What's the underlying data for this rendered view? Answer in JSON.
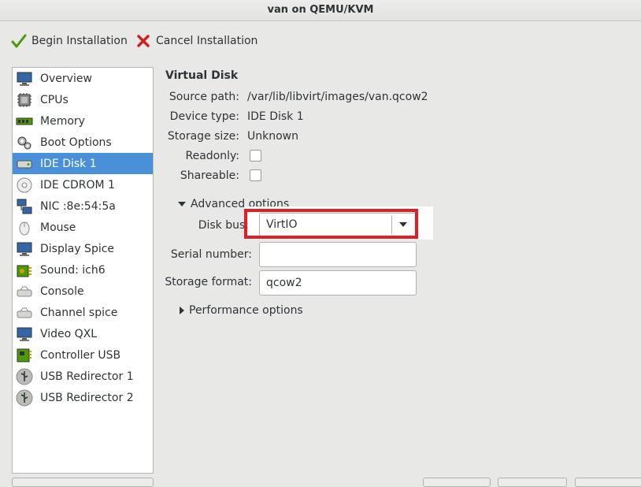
{
  "window": {
    "title": "van on QEMU/KVM"
  },
  "toolbar": {
    "begin_label": "Begin Installation",
    "cancel_label": "Cancel Installation"
  },
  "sidebar": {
    "items": [
      {
        "label": "Overview",
        "icon": "monitor-icon"
      },
      {
        "label": "CPUs",
        "icon": "cpu-icon"
      },
      {
        "label": "Memory",
        "icon": "memory-icon"
      },
      {
        "label": "Boot Options",
        "icon": "gears-icon"
      },
      {
        "label": "IDE Disk 1",
        "icon": "hard-disk-icon",
        "selected": true
      },
      {
        "label": "IDE CDROM 1",
        "icon": "cdrom-icon"
      },
      {
        "label": "NIC :8e:54:5a",
        "icon": "network-icon"
      },
      {
        "label": "Mouse",
        "icon": "mouse-icon"
      },
      {
        "label": "Display Spice",
        "icon": "display-icon"
      },
      {
        "label": "Sound: ich6",
        "icon": "sound-card-icon"
      },
      {
        "label": "Console",
        "icon": "console-icon"
      },
      {
        "label": "Channel spice",
        "icon": "channel-icon"
      },
      {
        "label": "Video QXL",
        "icon": "video-icon"
      },
      {
        "label": "Controller USB",
        "icon": "controller-icon"
      },
      {
        "label": "USB Redirector 1",
        "icon": "usb-icon"
      },
      {
        "label": "USB Redirector 2",
        "icon": "usb-icon"
      }
    ]
  },
  "disk": {
    "section_title": "Virtual Disk",
    "source_path_label": "Source path:",
    "source_path": "/var/lib/libvirt/images/van.qcow2",
    "device_type_label": "Device type:",
    "device_type": "IDE Disk 1",
    "storage_size_label": "Storage size:",
    "storage_size": "Unknown",
    "readonly_label": "Readonly:",
    "shareable_label": "Shareable:"
  },
  "advanced": {
    "label": "Advanced options",
    "disk_bus_label": "Disk bus:",
    "disk_bus_value": "VirtIO",
    "serial_label": "Serial number:",
    "serial_value": "",
    "format_label": "Storage format:",
    "format_value": "qcow2"
  },
  "performance": {
    "label": "Performance options"
  },
  "colors": {
    "selection": "#4a90d9",
    "highlight": "#e11d26"
  }
}
